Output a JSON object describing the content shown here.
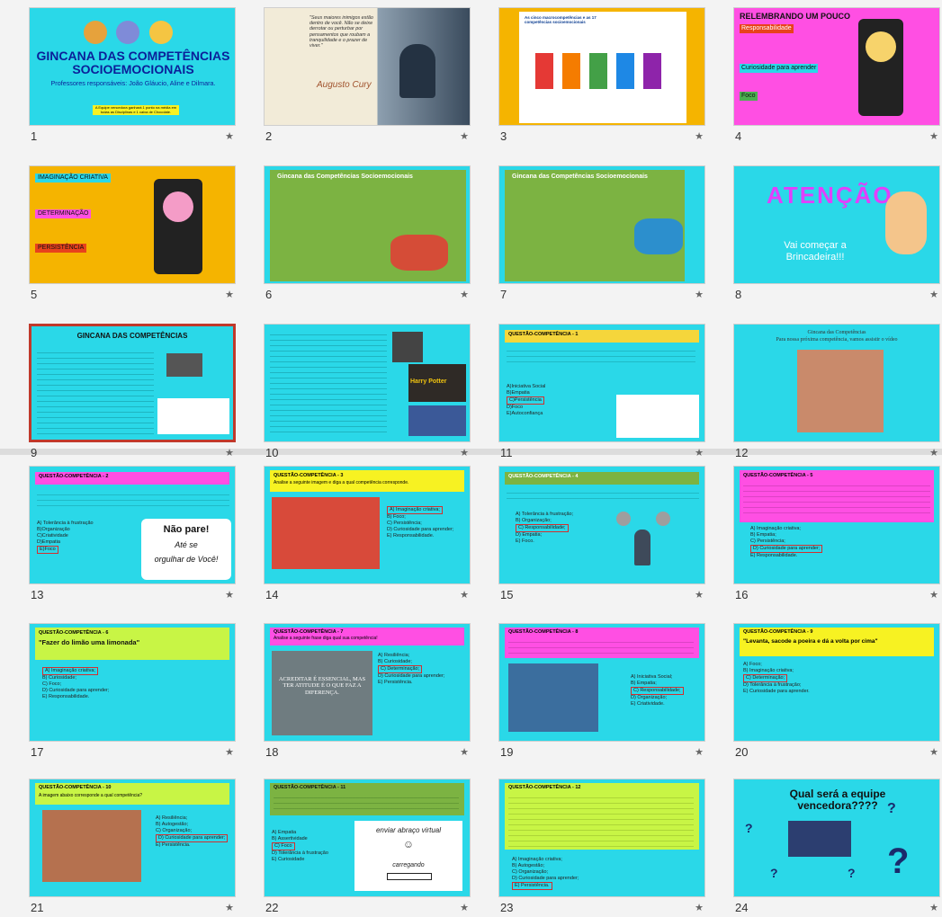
{
  "colors": {
    "teal": "#00d4dd",
    "magenta": "#ff4fe3",
    "yellow": "#f7f222",
    "lime": "#c8f545",
    "green": "#7cb342",
    "orange": "#f5b400",
    "accent_red": "#d32f2f"
  },
  "slides": [
    {
      "n": "1",
      "title": "GINCANA DAS COMPETÊNCIAS SOCIOEMOCIONAIS",
      "sub": "Professores responsáveis: João Gláucio, Aline e Dilmara.",
      "note": "A Equipe vencedora ganhará 1 ponto na média em todas as Disciplinas e 1 caixa de Chocolate."
    },
    {
      "n": "2",
      "quote": "\"Seus maiores inimigos estão dentro de você. Não se deixe derrotar ou perturbar por pensamentos que roubam a tranquilidade e o prazer de viver.\"",
      "author": "Augusto Cury"
    },
    {
      "n": "3",
      "title": "As cinco macrocompetências e as 17 competências socioemocionais"
    },
    {
      "n": "4",
      "title": "RELEMBRANDO UM POUCO",
      "items": [
        "Responsabilidade",
        "Curiosidade para aprender",
        "Foco"
      ]
    },
    {
      "n": "5",
      "items": [
        "IMAGINAÇÃO CRIATIVA",
        "DETERMINAÇÃO",
        "PERSISTÊNCIA"
      ]
    },
    {
      "n": "6",
      "title": "Gincana das Competências Socioemocionais"
    },
    {
      "n": "7",
      "title": "Gincana das Competências Socioemocionais"
    },
    {
      "n": "8",
      "title": "ATENÇÃO",
      "sub": "Vai começar a Brincadeira!!!"
    },
    {
      "n": "9",
      "title": "GINCANA DAS COMPETÊNCIAS"
    },
    {
      "n": "10",
      "title": "Harry Potter"
    },
    {
      "n": "11",
      "q": "QUESTÃO-COMPETÊNCIA - 1",
      "opts": [
        "A)Iniciativa Social",
        "B)Empatia",
        "C)Persistência",
        "D)Foco",
        "E)Autoconfiança"
      ]
    },
    {
      "n": "12",
      "title": "Gincana das Competências",
      "sub": "Para nossa próxima competência, vamos assistir o vídeo"
    },
    {
      "n": "13",
      "q": "QUESTÃO-COMPETÊNCIA - 2",
      "opts": [
        "A) Tolerância à frustração",
        "B)Organização",
        "C)Criatividade",
        "D)Empatia",
        "E)Foco"
      ],
      "img": [
        "Não pare!",
        "Até se",
        "orgulhar de Você!"
      ]
    },
    {
      "n": "14",
      "q": "QUESTÃO-COMPETÊNCIA - 3",
      "sub": "Analise a seguinte imagem e diga a qual competência corresponde.",
      "opts": [
        "A) Imaginação criativa;",
        "B) Foco;",
        "C) Persistência;",
        "D) Curiosidade para aprender;",
        "E) Responsabilidade."
      ]
    },
    {
      "n": "15",
      "q": "QUESTÃO-COMPETÊNCIA - 4",
      "opts": [
        "A) Tolerância à frustração;",
        "B) Organização;",
        "C) Responsabilidade;",
        "D) Empatia;",
        "E) Foco."
      ]
    },
    {
      "n": "16",
      "q": "QUESTÃO-COMPETÊNCIA - 5",
      "opts": [
        "A) Imaginação criativa;",
        "B) Empatia;",
        "C) Persistência;",
        "D) Curiosidade para aprender;",
        "E) Responsabilidade."
      ]
    },
    {
      "n": "17",
      "q": "QUESTÃO-COMPETÊNCIA - 6",
      "sub": "\"Fazer do limão uma limonada\"",
      "opts": [
        "A) Imaginação criativa;",
        "B) Curiosidade;",
        "C) Foco;",
        "D) Curiosidade para aprender;",
        "E) Responsabilidade."
      ]
    },
    {
      "n": "18",
      "q": "QUESTÃO-COMPETÊNCIA - 7",
      "sub": "Analise a seguinte frase diga qual sua competência!",
      "opts": [
        "A) Resiliência;",
        "B) Curiosidade;",
        "C) Determinação;",
        "D) Curiosidade para aprender;",
        "E) Persistência."
      ],
      "img": "ACREDITAR É ESSENCIAL, MAS TER ATITUDE É O QUE FAZ A DIFERENÇA."
    },
    {
      "n": "19",
      "q": "QUESTÃO-COMPETÊNCIA - 8",
      "opts": [
        "A) Iniciativa Social;",
        "B) Empatia;",
        "C) Responsabilidade;",
        "D) Organização;",
        "E) Criatividade."
      ]
    },
    {
      "n": "20",
      "q": "QUESTÃO-COMPETÊNCIA - 9",
      "sub": "\"Levanta, sacode a poeira e dá a volta por cima\"",
      "opts": [
        "A) Foco;",
        "B) Imaginação criativa;",
        "C) Determinação;",
        "D) Tolerância à frustração;",
        "E) Curiosidade para aprender."
      ]
    },
    {
      "n": "21",
      "q": "QUESTÃO-COMPETÊNCIA - 10",
      "sub": "A imagem abaixo corresponde a qual competência?",
      "opts": [
        "A) Resiliência;",
        "B) Autogestão;",
        "C) Organização;",
        "D) Curiosidade para aprender;",
        "E) Persistência."
      ]
    },
    {
      "n": "22",
      "q": "QUESTÃO-COMPETÊNCIA - 11",
      "opts": [
        "A) Empatia",
        "B) Assertividade",
        "C) Foco",
        "D) Tolerância à frustração",
        "E) Curiosidade"
      ],
      "img": [
        "enviar abraço virtual",
        "carregando"
      ]
    },
    {
      "n": "23",
      "q": "QUESTÃO-COMPETÊNCIA - 12",
      "opts": [
        "A) Imaginação criativa;",
        "B) Autogestão;",
        "C) Organização;",
        "D) Curiosidade para aprender;",
        "E) Persistência."
      ]
    },
    {
      "n": "24",
      "title": "Qual será a equipe vencedora????",
      "marks": [
        "?",
        "?",
        "?",
        "?",
        "?"
      ]
    }
  ],
  "star": "★"
}
